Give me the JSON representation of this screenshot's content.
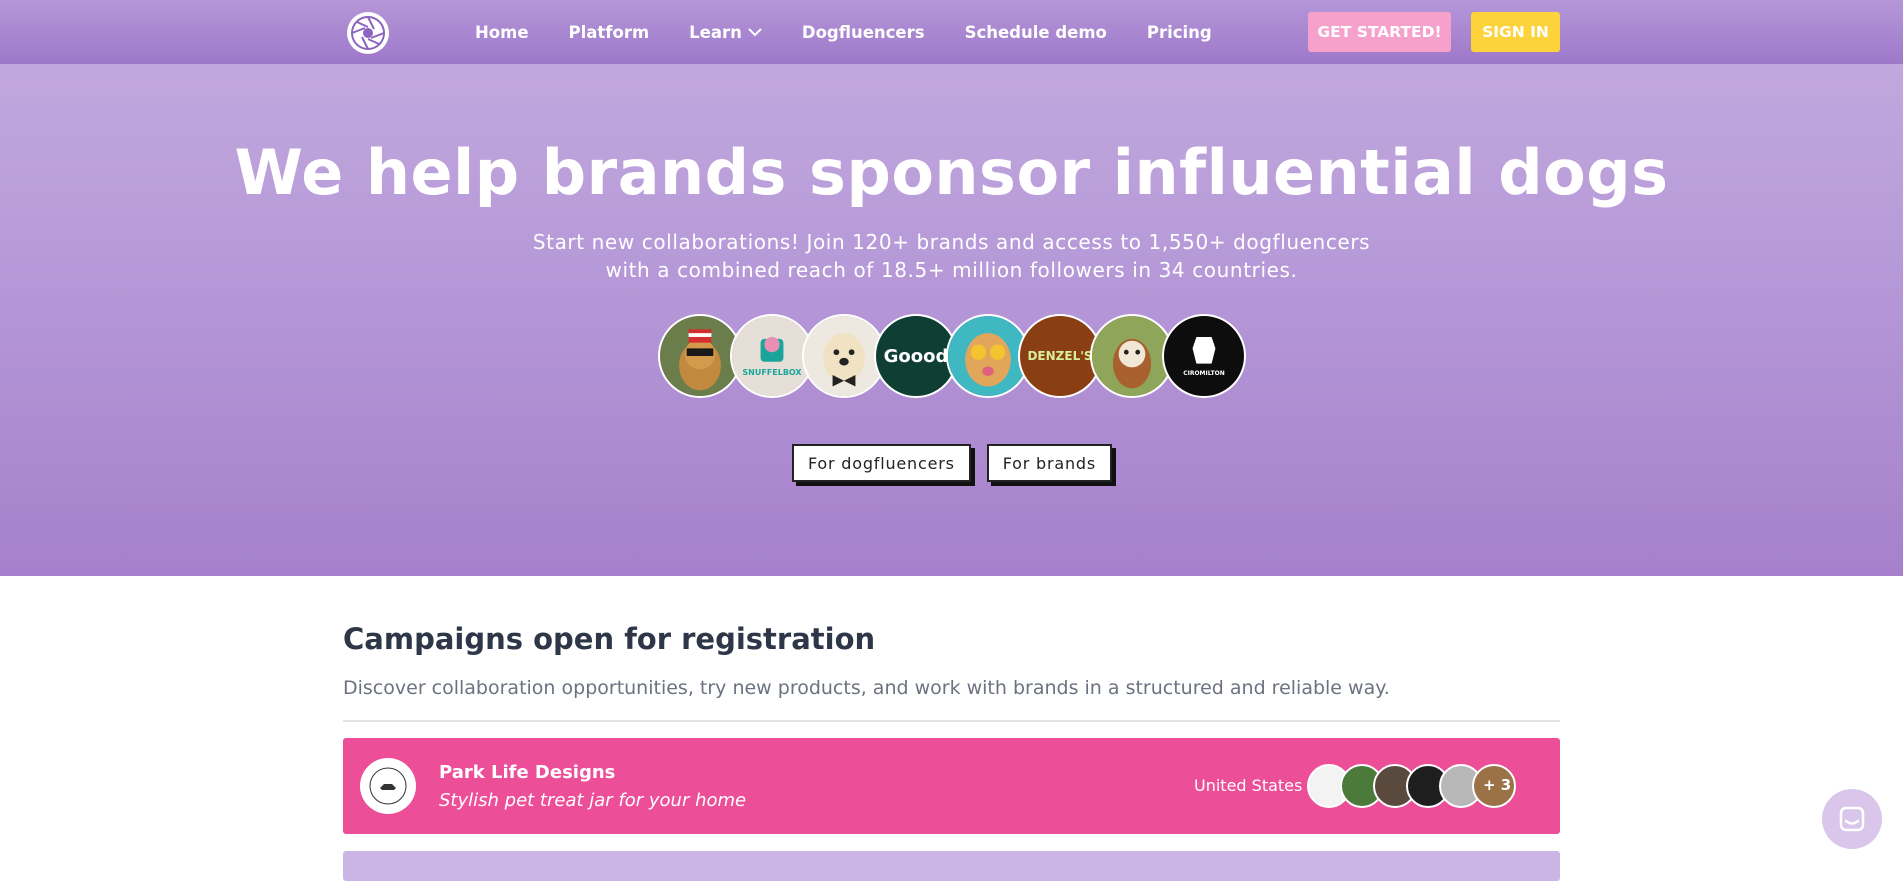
{
  "nav": {
    "links": [
      "Home",
      "Platform",
      "Learn",
      "Dogfluencers",
      "Schedule demo",
      "Pricing"
    ],
    "get_started": "GET STARTED!",
    "sign_in": "SIGN IN"
  },
  "hero": {
    "title": "We help brands sponsor influential dogs",
    "subtitle_line1": "Start new collaborations! Join 120+ brands and access to 1,550+ dogfluencers",
    "subtitle_line2": "with a combined reach of 18.5+ million followers in 34 countries.",
    "avatar_labels": {
      "snuffelbox": "SNUFFELBOX",
      "goood": "Goood",
      "denzels": "DENZEL'S",
      "ciro": "CIROMILTON"
    },
    "button_dogfluencers": "For dogfluencers",
    "button_brands": "For brands"
  },
  "campaigns": {
    "title": "Campaigns open for registration",
    "subtitle": "Discover collaboration opportunities, try new products, and work with brands in a structured and reliable way.",
    "items": [
      {
        "brand": "Park Life Designs",
        "description": "Stylish pet treat jar for your home",
        "country": "United States",
        "more": "+ 3"
      }
    ]
  },
  "colors": {
    "accent_pink": "#ec4f98",
    "get_started_bg": "#f6a1cc",
    "sign_in_bg": "#fcd33a",
    "hero_purple": "#a680cc"
  },
  "icons": {
    "logo": "camera-aperture-icon",
    "learn_dropdown": "chevron-down-icon",
    "chat": "chat-icon"
  }
}
